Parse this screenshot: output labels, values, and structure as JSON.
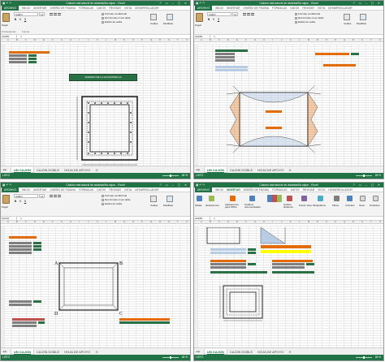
{
  "window": {
    "title": "Calculo estructural de alcantarilla cajon - Excel",
    "title_left": "Calculo estructural de alcantarilla cajon - Excel",
    "user": "Iniciar sesión"
  },
  "menu_tabs": [
    "ARCHIVO",
    "INICIO",
    "INSERTAR",
    "DISEÑO DE PÁGINA",
    "FÓRMULAS",
    "DATOS",
    "REVISAR",
    "VISTA",
    "DESARROLLADOR"
  ],
  "ribbon_home": {
    "paste": "Pegar",
    "font_name": "Calibri",
    "font_size": "11",
    "group_clipboard": "Portapapeles",
    "group_font": "Fuente",
    "group_alignment": "Alineación",
    "group_number": "Número",
    "group_styles": "Estilos",
    "group_cells": "Celdas",
    "group_edit": "Modificar",
    "conditional_format": "Formato condicional",
    "format_table": "Dar formato como tabla",
    "cell_styles": "Estilos de celda",
    "cells": "Celdas",
    "edit": "Modificar",
    "number_format": "%"
  },
  "ribbon_insert": {
    "tables": "Tablas",
    "illustrations": "Ilustraciones",
    "apps": "Aplicaciones para Office",
    "rec_charts": "Gráficos recomendados",
    "pivot_chart": "Gráfico dinámico",
    "sparklines": "Minigráficos",
    "filters": "Filtros",
    "links": "Vínculos",
    "text": "Texto",
    "symbols": "Símbolos",
    "power_view": "Power View",
    "group_charts": "Gráficos",
    "group_reports": "Informes"
  },
  "name_boxes": [
    "AA185",
    "AA189",
    "AA149",
    "AA189"
  ],
  "formula_fx": "fx",
  "col_headers": [
    "A",
    "B",
    "C",
    "D",
    "E",
    "F",
    "G",
    "H",
    "I",
    "J",
    "K",
    "L",
    "M",
    "N",
    "O",
    "P",
    "Q",
    "R",
    "S",
    "T",
    "U"
  ],
  "sheet_tabs": [
    "UN CAJON",
    "CAJON DOBLE",
    "HOJA DE APOYO"
  ],
  "status": {
    "ready": "LISTO",
    "zooms": [
      "48 %",
      "48 %",
      "48 %",
      "48 %"
    ]
  },
  "content": {
    "armado_title": "ARMADO DE LA ALCANTARILLA",
    "point_labels": [
      "A",
      "B",
      "C",
      "D"
    ],
    "banner_p3_1": "DIAGRAMA DE DISTRIBUCIÓN DE ACERO DE REFUERZO",
    "banner_p3_2": "ARMADO DE LA ESTRUCTURA",
    "banner_p2_1": "MOMENTOS DE DISEÑO"
  },
  "colors": {
    "excel_green": "#217346",
    "header_orange": "#e36c09",
    "header_brown": "#c0504d",
    "cell_gray": "#7f7f7f",
    "dark_green": "#2a7045",
    "yellow": "#ffff00",
    "light_blue": "#b8cce4"
  }
}
